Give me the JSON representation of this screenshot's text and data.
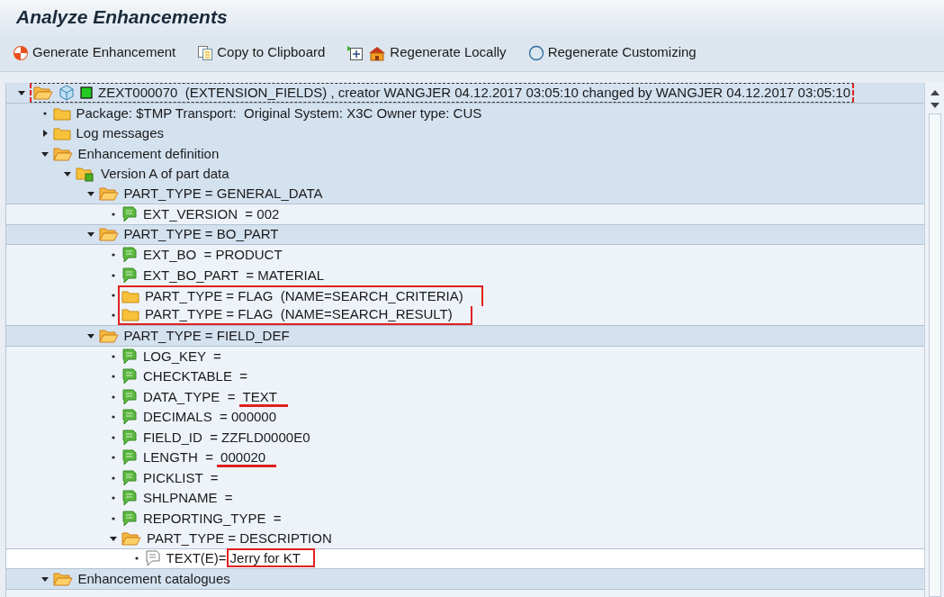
{
  "window": {
    "title": "Analyze Enhancements"
  },
  "toolbar": [
    {
      "kind": "button",
      "label": "Generate Enhancement"
    },
    {
      "kind": "button",
      "label": "Copy to Clipboard"
    },
    {
      "kind": "icon"
    },
    {
      "kind": "button",
      "label": "Regenerate Locally"
    },
    {
      "kind": "button",
      "label": "Regenerate Customizing"
    }
  ],
  "tree": [
    {
      "kind": "object",
      "label": "ZEXT000070  (EXTENSION_FIELDS) , creator WANGJER 04.12.2017 03:05:10 changed by WANGJER 04.12.2017 03:05:10",
      "expanded": true,
      "focused": true,
      "children": [
        {
          "kind": "folder",
          "label": "Package: $TMP Transport:  Original System: X3C Owner type: CUS"
        },
        {
          "kind": "folder",
          "label": "Log messages",
          "expanded": false
        },
        {
          "kind": "folder",
          "label": "Enhancement definition",
          "expanded": true,
          "children": [
            {
              "kind": "version",
              "label": "Version A of part data",
              "expanded": true,
              "children": [
                {
                  "kind": "folder",
                  "label": "PART_TYPE = GENERAL_DATA",
                  "expanded": true,
                  "children": [
                    {
                      "kind": "attribute",
                      "label": "EXT_VERSION  = 002"
                    }
                  ]
                },
                {
                  "kind": "folder",
                  "label": "PART_TYPE = BO_PART",
                  "expanded": true,
                  "children": [
                    {
                      "kind": "attribute",
                      "label": "EXT_BO  = PRODUCT"
                    },
                    {
                      "kind": "attribute",
                      "label": "EXT_BO_PART  = MATERIAL"
                    },
                    {
                      "kind": "folder",
                      "label": "PART_TYPE = FLAG  (NAME=SEARCH_CRITERIA)",
                      "boxed": true
                    },
                    {
                      "kind": "folder",
                      "label": "PART_TYPE = FLAG  (NAME=SEARCH_RESULT)",
                      "boxed": true
                    }
                  ]
                },
                {
                  "kind": "folder",
                  "label": "PART_TYPE = FIELD_DEF",
                  "expanded": true,
                  "children": [
                    {
                      "kind": "attribute",
                      "label": "LOG_KEY  ="
                    },
                    {
                      "kind": "attribute",
                      "label": "CHECKTABLE  ="
                    },
                    {
                      "kind": "attribute",
                      "label": "DATA_TYPE  = ",
                      "marked": "TEXT",
                      "underlined": true
                    },
                    {
                      "kind": "attribute",
                      "label": "DECIMALS  = 000000"
                    },
                    {
                      "kind": "attribute",
                      "label": "FIELD_ID  = ZZFLD0000E0"
                    },
                    {
                      "kind": "attribute",
                      "label": "LENGTH  = ",
                      "marked": "000020",
                      "underlined": true
                    },
                    {
                      "kind": "attribute",
                      "label": "PICKLIST  ="
                    },
                    {
                      "kind": "attribute",
                      "label": "SHLPNAME  ="
                    },
                    {
                      "kind": "attribute",
                      "label": "REPORTING_TYPE  ="
                    },
                    {
                      "kind": "folder",
                      "label": "PART_TYPE = DESCRIPTION",
                      "expanded": true,
                      "children": [
                        {
                          "kind": "text",
                          "label": "TEXT(E)=",
                          "marked": "Jerry for KT",
                          "framed": true
                        }
                      ]
                    }
                  ]
                }
              ]
            }
          ]
        },
        {
          "kind": "folder",
          "label": "Enhancement catalogues",
          "expanded": true
        }
      ]
    }
  ]
}
